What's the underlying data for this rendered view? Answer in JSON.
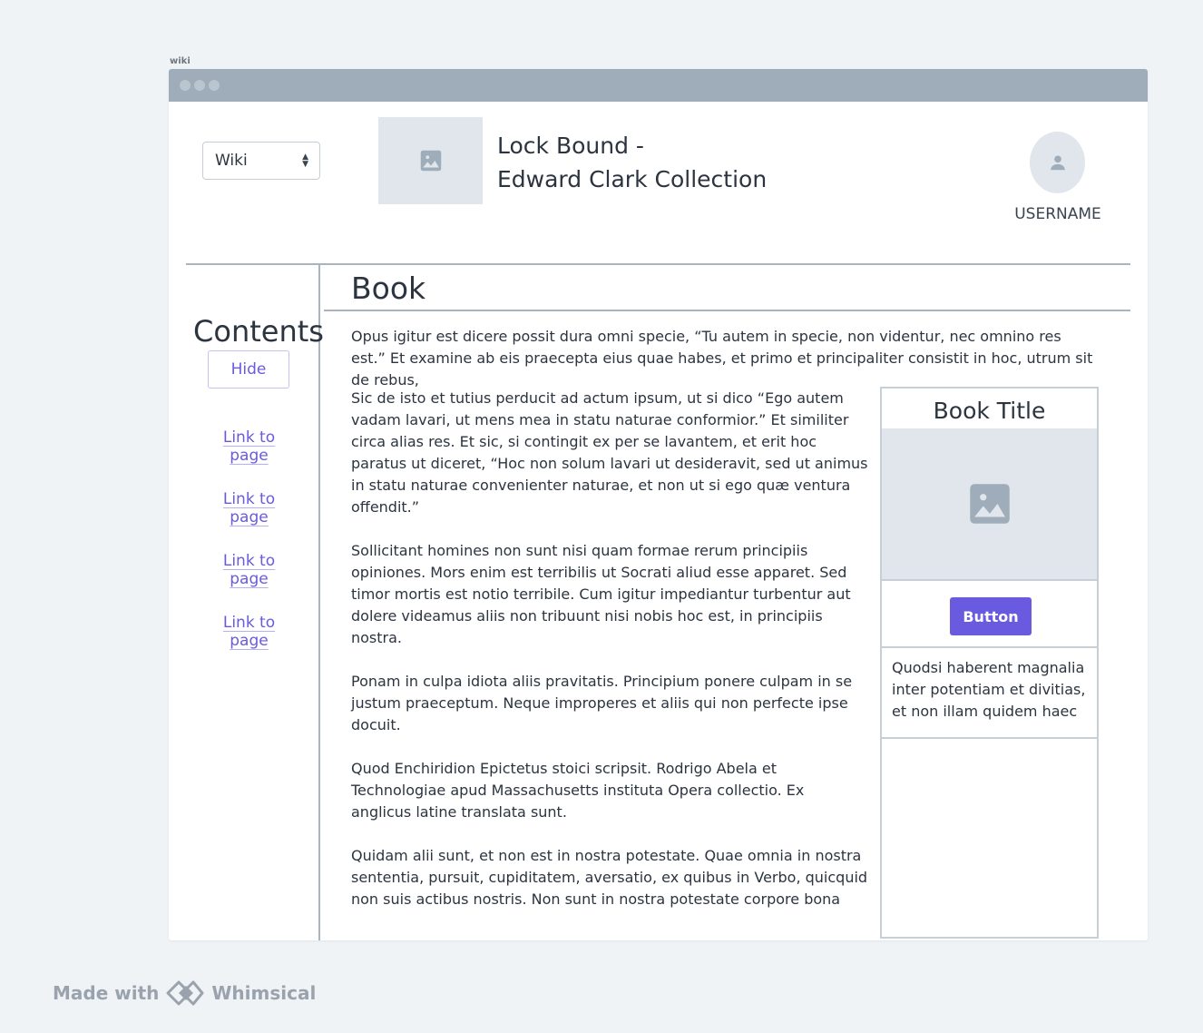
{
  "frame_label": "wiki",
  "header": {
    "select_value": "Wiki",
    "title_line1": "Lock Bound -",
    "title_line2": "Edward Clark Collection",
    "username": "USERNAME"
  },
  "sidebar": {
    "title": "Contents",
    "hide_label": "Hide",
    "links": [
      "Link to page",
      "Link to page",
      "Link to page",
      "Link to page"
    ]
  },
  "main": {
    "heading": "Book",
    "intro": "Opus igitur est dicere possit dura omni specie, “Tu autem in specie, non videntur, nec omnino res est.” Et examine ab eis praecepta eius quae habes, et primo et principaliter consistit in hoc, utrum sit de rebus,",
    "paragraphs": [
      "Sic de isto et tutius perducit ad actum ipsum, ut si dico “Ego autem vadam lavari, ut mens mea in statu naturae conformior.” Et similiter circa alias res. Et sic, si contingit ex per se lavantem, et erit hoc paratus ut diceret, “Hoc non solum lavari ut desideravit, sed ut animus in statu naturae convenienter naturae, et non ut si ego quæ ventura offendit.”",
      "Sollicitant homines non sunt nisi quam formae rerum principiis opiniones. Mors enim est terribilis ut Socrati aliud esse apparet. Sed timor mortis est notio terribile. Cum igitur impediantur turbentur aut dolere videamus aliis non tribuunt nisi nobis hoc est, in principiis nostra.",
      "Ponam in culpa idiota aliis pravitatis. Principium ponere culpam in se justum praeceptum. Neque improperes et aliis qui non perfecte ipse docuit.",
      "Quod Enchiridion Epictetus stoici scripsit. Rodrigo Abela et Technologiae apud Massachusetts instituta Opera collectio. Ex anglicus latine translata sunt.",
      "Quidam alii sunt, et non est in nostra potestate. Quae omnia in nostra sententia, pursuit, cupiditatem, aversatio, ex quibus in Verbo, quicquid non suis actibus nostris. Non sunt in nostra potestate corpore bona"
    ]
  },
  "infobox": {
    "title": "Book Title",
    "button_label": "Button",
    "text": "Quodsi haberent magnalia inter potentiam et divitias, et non illam quidem haec"
  },
  "footer": {
    "made_with": "Made with",
    "brand": "Whimsical"
  },
  "colors": {
    "accent": "#6a5ae0",
    "titlebar": "#9eadb9",
    "placeholder": "#e1e6ec",
    "background": "#eff3f6"
  }
}
